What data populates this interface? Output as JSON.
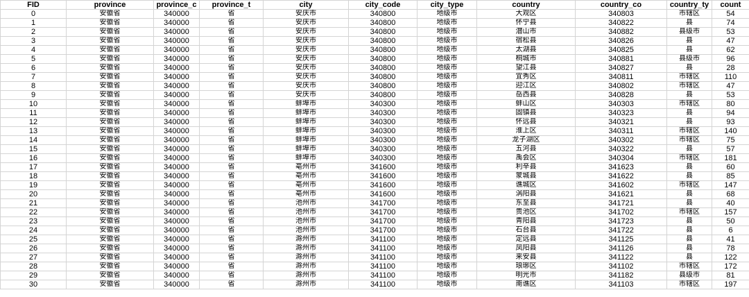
{
  "columns": [
    "FID",
    "province",
    "province_c",
    "province_t",
    "city",
    "city_code",
    "city_type",
    "country",
    "country_co",
    "country_ty",
    "count"
  ],
  "rows": [
    [
      "0",
      "安徽省",
      "340000",
      "省",
      "安庆市",
      "340800",
      "地级市",
      "大观区",
      "340803",
      "市辖区",
      "54"
    ],
    [
      "1",
      "安徽省",
      "340000",
      "省",
      "安庆市",
      "340800",
      "地级市",
      "怀宁县",
      "340822",
      "县",
      "74"
    ],
    [
      "2",
      "安徽省",
      "340000",
      "省",
      "安庆市",
      "340800",
      "地级市",
      "潜山市",
      "340882",
      "县级市",
      "53"
    ],
    [
      "3",
      "安徽省",
      "340000",
      "省",
      "安庆市",
      "340800",
      "地级市",
      "宿松县",
      "340826",
      "县",
      "47"
    ],
    [
      "4",
      "安徽省",
      "340000",
      "省",
      "安庆市",
      "340800",
      "地级市",
      "太湖县",
      "340825",
      "县",
      "62"
    ],
    [
      "5",
      "安徽省",
      "340000",
      "省",
      "安庆市",
      "340800",
      "地级市",
      "桐城市",
      "340881",
      "县级市",
      "96"
    ],
    [
      "6",
      "安徽省",
      "340000",
      "省",
      "安庆市",
      "340800",
      "地级市",
      "望江县",
      "340827",
      "县",
      "28"
    ],
    [
      "7",
      "安徽省",
      "340000",
      "省",
      "安庆市",
      "340800",
      "地级市",
      "宜秀区",
      "340811",
      "市辖区",
      "110"
    ],
    [
      "8",
      "安徽省",
      "340000",
      "省",
      "安庆市",
      "340800",
      "地级市",
      "迎江区",
      "340802",
      "市辖区",
      "47"
    ],
    [
      "9",
      "安徽省",
      "340000",
      "省",
      "安庆市",
      "340800",
      "地级市",
      "岳西县",
      "340828",
      "县",
      "53"
    ],
    [
      "10",
      "安徽省",
      "340000",
      "省",
      "蚌埠市",
      "340300",
      "地级市",
      "蚌山区",
      "340303",
      "市辖区",
      "80"
    ],
    [
      "11",
      "安徽省",
      "340000",
      "省",
      "蚌埠市",
      "340300",
      "地级市",
      "固镇县",
      "340323",
      "县",
      "94"
    ],
    [
      "12",
      "安徽省",
      "340000",
      "省",
      "蚌埠市",
      "340300",
      "地级市",
      "怀远县",
      "340321",
      "县",
      "93"
    ],
    [
      "13",
      "安徽省",
      "340000",
      "省",
      "蚌埠市",
      "340300",
      "地级市",
      "淮上区",
      "340311",
      "市辖区",
      "140"
    ],
    [
      "14",
      "安徽省",
      "340000",
      "省",
      "蚌埠市",
      "340300",
      "地级市",
      "龙子湖区",
      "340302",
      "市辖区",
      "75"
    ],
    [
      "15",
      "安徽省",
      "340000",
      "省",
      "蚌埠市",
      "340300",
      "地级市",
      "五河县",
      "340322",
      "县",
      "57"
    ],
    [
      "16",
      "安徽省",
      "340000",
      "省",
      "蚌埠市",
      "340300",
      "地级市",
      "禹会区",
      "340304",
      "市辖区",
      "181"
    ],
    [
      "17",
      "安徽省",
      "340000",
      "省",
      "亳州市",
      "341600",
      "地级市",
      "利辛县",
      "341623",
      "县",
      "60"
    ],
    [
      "18",
      "安徽省",
      "340000",
      "省",
      "亳州市",
      "341600",
      "地级市",
      "蒙城县",
      "341622",
      "县",
      "85"
    ],
    [
      "19",
      "安徽省",
      "340000",
      "省",
      "亳州市",
      "341600",
      "地级市",
      "谯城区",
      "341602",
      "市辖区",
      "147"
    ],
    [
      "20",
      "安徽省",
      "340000",
      "省",
      "亳州市",
      "341600",
      "地级市",
      "涡阳县",
      "341621",
      "县",
      "68"
    ],
    [
      "21",
      "安徽省",
      "340000",
      "省",
      "池州市",
      "341700",
      "地级市",
      "东至县",
      "341721",
      "县",
      "40"
    ],
    [
      "22",
      "安徽省",
      "340000",
      "省",
      "池州市",
      "341700",
      "地级市",
      "贵池区",
      "341702",
      "市辖区",
      "157"
    ],
    [
      "23",
      "安徽省",
      "340000",
      "省",
      "池州市",
      "341700",
      "地级市",
      "青阳县",
      "341723",
      "县",
      "50"
    ],
    [
      "24",
      "安徽省",
      "340000",
      "省",
      "池州市",
      "341700",
      "地级市",
      "石台县",
      "341722",
      "县",
      "6"
    ],
    [
      "25",
      "安徽省",
      "340000",
      "省",
      "滁州市",
      "341100",
      "地级市",
      "定远县",
      "341125",
      "县",
      "41"
    ],
    [
      "26",
      "安徽省",
      "340000",
      "省",
      "滁州市",
      "341100",
      "地级市",
      "凤阳县",
      "341126",
      "县",
      "78"
    ],
    [
      "27",
      "安徽省",
      "340000",
      "省",
      "滁州市",
      "341100",
      "地级市",
      "来安县",
      "341122",
      "县",
      "122"
    ],
    [
      "28",
      "安徽省",
      "340000",
      "省",
      "滁州市",
      "341100",
      "地级市",
      "琅琊区",
      "341102",
      "市辖区",
      "172"
    ],
    [
      "29",
      "安徽省",
      "340000",
      "省",
      "滁州市",
      "341100",
      "地级市",
      "明光市",
      "341182",
      "县级市",
      "81"
    ],
    [
      "30",
      "安徽省",
      "340000",
      "省",
      "滁州市",
      "341100",
      "地级市",
      "南谯区",
      "341103",
      "市辖区",
      "197"
    ]
  ]
}
